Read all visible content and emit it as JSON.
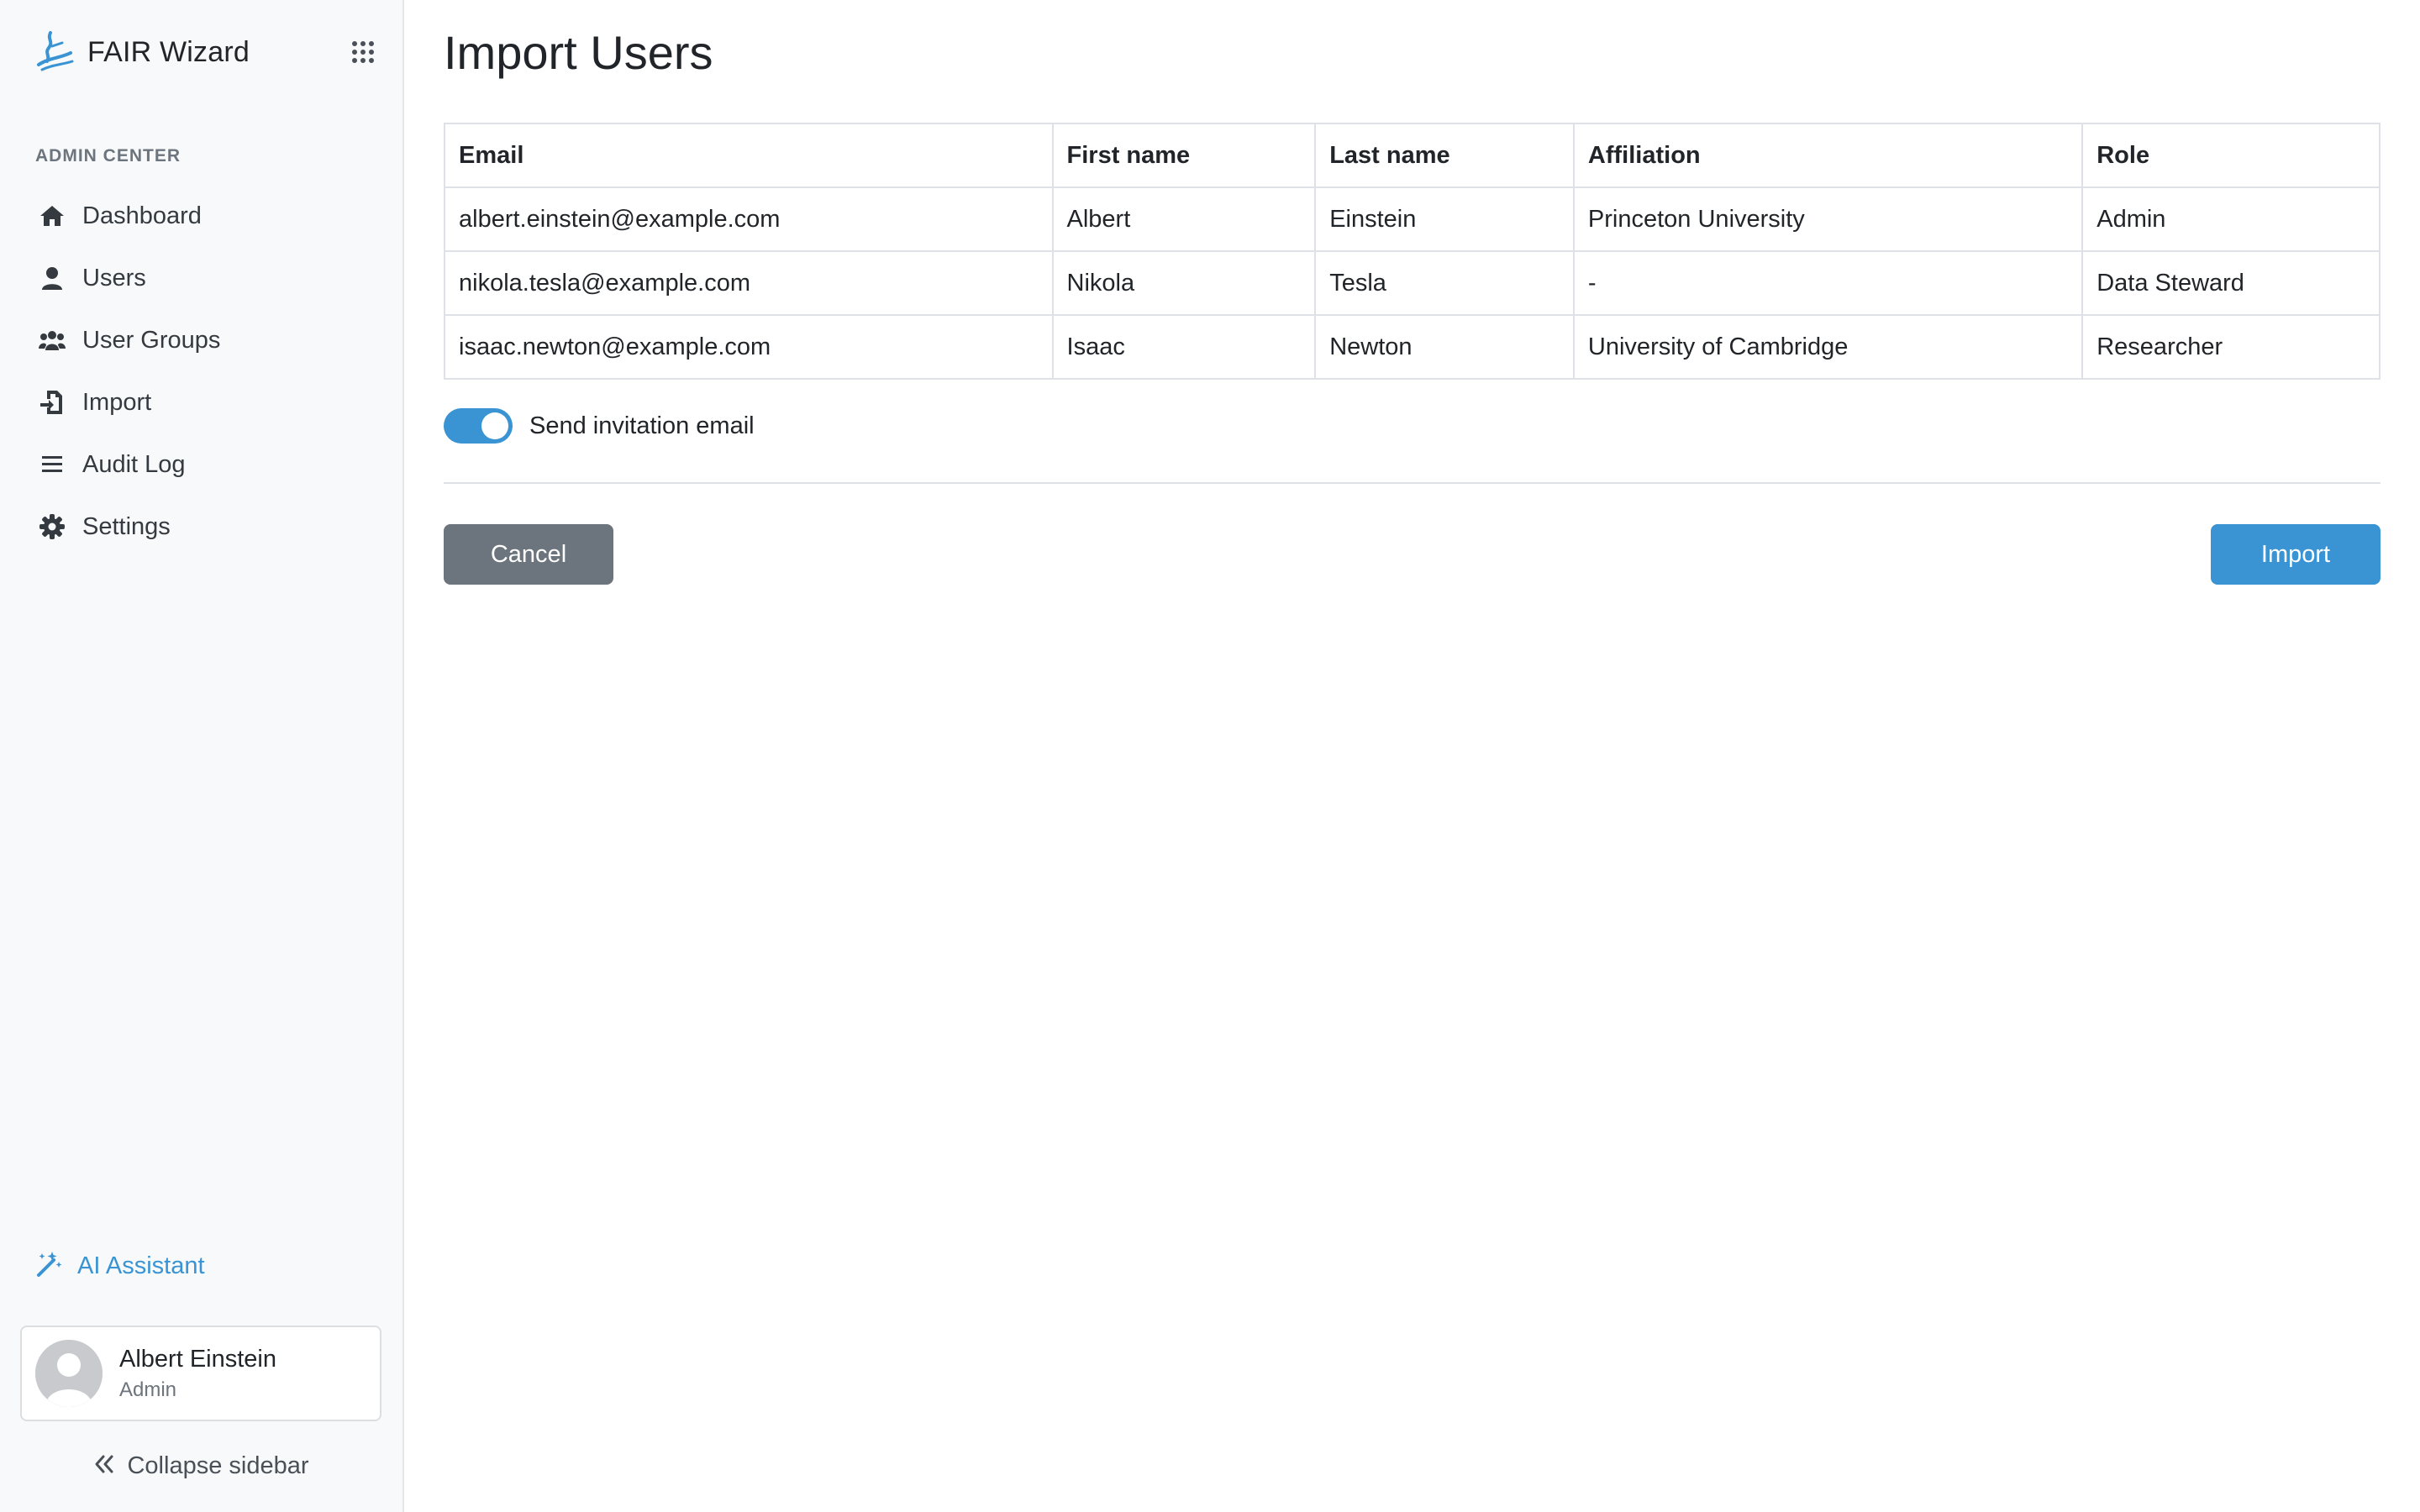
{
  "brand": {
    "name": "FAIR Wizard"
  },
  "sidebar": {
    "section_label": "ADMIN CENTER",
    "items": [
      {
        "label": "Dashboard",
        "icon": "home-icon"
      },
      {
        "label": "Users",
        "icon": "user-icon"
      },
      {
        "label": "User Groups",
        "icon": "users-icon"
      },
      {
        "label": "Import",
        "icon": "file-import-icon"
      },
      {
        "label": "Audit Log",
        "icon": "list-icon"
      },
      {
        "label": "Settings",
        "icon": "gear-icon"
      }
    ],
    "ai_assistant": {
      "label": "AI Assistant",
      "icon": "magic-wand-icon"
    },
    "profile": {
      "name": "Albert Einstein",
      "role": "Admin"
    },
    "collapse_label": "Collapse sidebar"
  },
  "page": {
    "title": "Import Users",
    "table": {
      "headers": [
        "Email",
        "First name",
        "Last name",
        "Affiliation",
        "Role"
      ],
      "rows": [
        [
          "albert.einstein@example.com",
          "Albert",
          "Einstein",
          "Princeton University",
          "Admin"
        ],
        [
          "nikola.tesla@example.com",
          "Nikola",
          "Tesla",
          "-",
          "Data Steward"
        ],
        [
          "isaac.newton@example.com",
          "Isaac",
          "Newton",
          "University of Cambridge",
          "Researcher"
        ]
      ]
    },
    "send_invitation": {
      "label": "Send invitation email",
      "checked": true
    },
    "cancel_label": "Cancel",
    "import_label": "Import"
  },
  "colors": {
    "accent": "#3a94d3",
    "secondary_button": "#6c757d",
    "sidebar_bg": "#f8f9fa"
  }
}
